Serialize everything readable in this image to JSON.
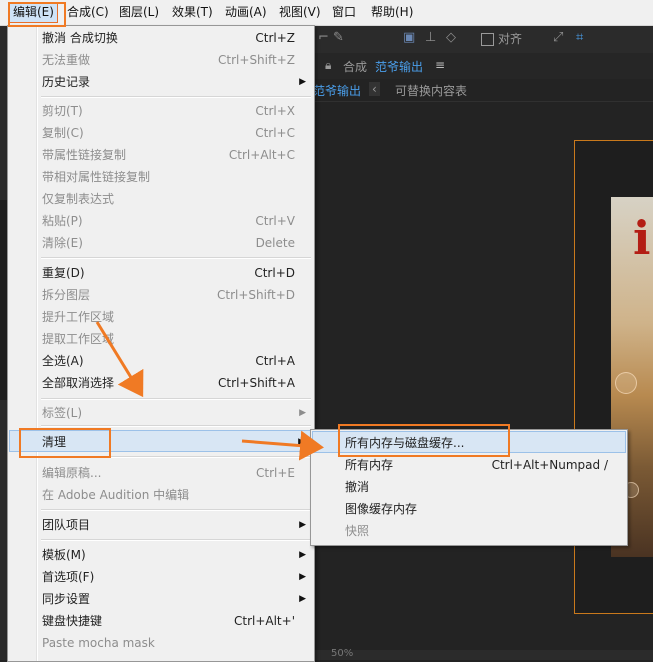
{
  "menubar": {
    "items": [
      "编辑(E)",
      "合成(C)",
      "图层(L)",
      "效果(T)",
      "动画(A)",
      "视图(V)",
      "窗口",
      "帮助(H)"
    ]
  },
  "toolbar": {
    "snap_label": "对齐"
  },
  "comp": {
    "header_prefix": "合成",
    "name": "范爷输出",
    "menu_glyph": "≡",
    "breadcrumb": "范爷输出",
    "back_glyph": "‹",
    "replaceable": "可替换内容表"
  },
  "viewer": {
    "zoom": "50%"
  },
  "edit_menu": {
    "items": [
      {
        "label": "撤消 合成切换",
        "shortcut": "Ctrl+Z"
      },
      {
        "label": "无法重做",
        "shortcut": "Ctrl+Shift+Z"
      },
      {
        "label": "历史记录",
        "shortcut": ""
      },
      {
        "label": "剪切(T)",
        "shortcut": "Ctrl+X"
      },
      {
        "label": "复制(C)",
        "shortcut": "Ctrl+C"
      },
      {
        "label": "带属性链接复制",
        "shortcut": "Ctrl+Alt+C"
      },
      {
        "label": "带相对属性链接复制",
        "shortcut": ""
      },
      {
        "label": "仅复制表达式",
        "shortcut": ""
      },
      {
        "label": "粘贴(P)",
        "shortcut": "Ctrl+V"
      },
      {
        "label": "清除(E)",
        "shortcut": "Delete"
      },
      {
        "label": "重复(D)",
        "shortcut": "Ctrl+D"
      },
      {
        "label": "拆分图层",
        "shortcut": "Ctrl+Shift+D"
      },
      {
        "label": "提升工作区域",
        "shortcut": ""
      },
      {
        "label": "提取工作区域",
        "shortcut": ""
      },
      {
        "label": "全选(A)",
        "shortcut": "Ctrl+A"
      },
      {
        "label": "全部取消选择",
        "shortcut": "Ctrl+Shift+A"
      },
      {
        "label": "标签(L)",
        "shortcut": ""
      },
      {
        "label": "清理",
        "shortcut": ""
      },
      {
        "label": "编辑原稿...",
        "shortcut": "Ctrl+E"
      },
      {
        "label": "在 Adobe Audition 中编辑",
        "shortcut": ""
      },
      {
        "label": "团队项目",
        "shortcut": ""
      },
      {
        "label": "模板(M)",
        "shortcut": ""
      },
      {
        "label": "首选项(F)",
        "shortcut": ""
      },
      {
        "label": "同步设置",
        "shortcut": ""
      },
      {
        "label": "键盘快捷键",
        "shortcut": "Ctrl+Alt+'"
      },
      {
        "label": "Paste mocha mask",
        "shortcut": ""
      }
    ]
  },
  "purge_menu": {
    "items": [
      {
        "label": "所有内存与磁盘缓存...",
        "shortcut": ""
      },
      {
        "label": "所有内存",
        "shortcut": "Ctrl+Alt+Numpad /"
      },
      {
        "label": "撤消",
        "shortcut": ""
      },
      {
        "label": "图像缓存内存",
        "shortcut": ""
      },
      {
        "label": "快照",
        "shortcut": ""
      }
    ]
  },
  "colors": {
    "annotation": "#f07a24",
    "accent_blue": "#4a9eea",
    "comp_border": "#c9791c"
  }
}
